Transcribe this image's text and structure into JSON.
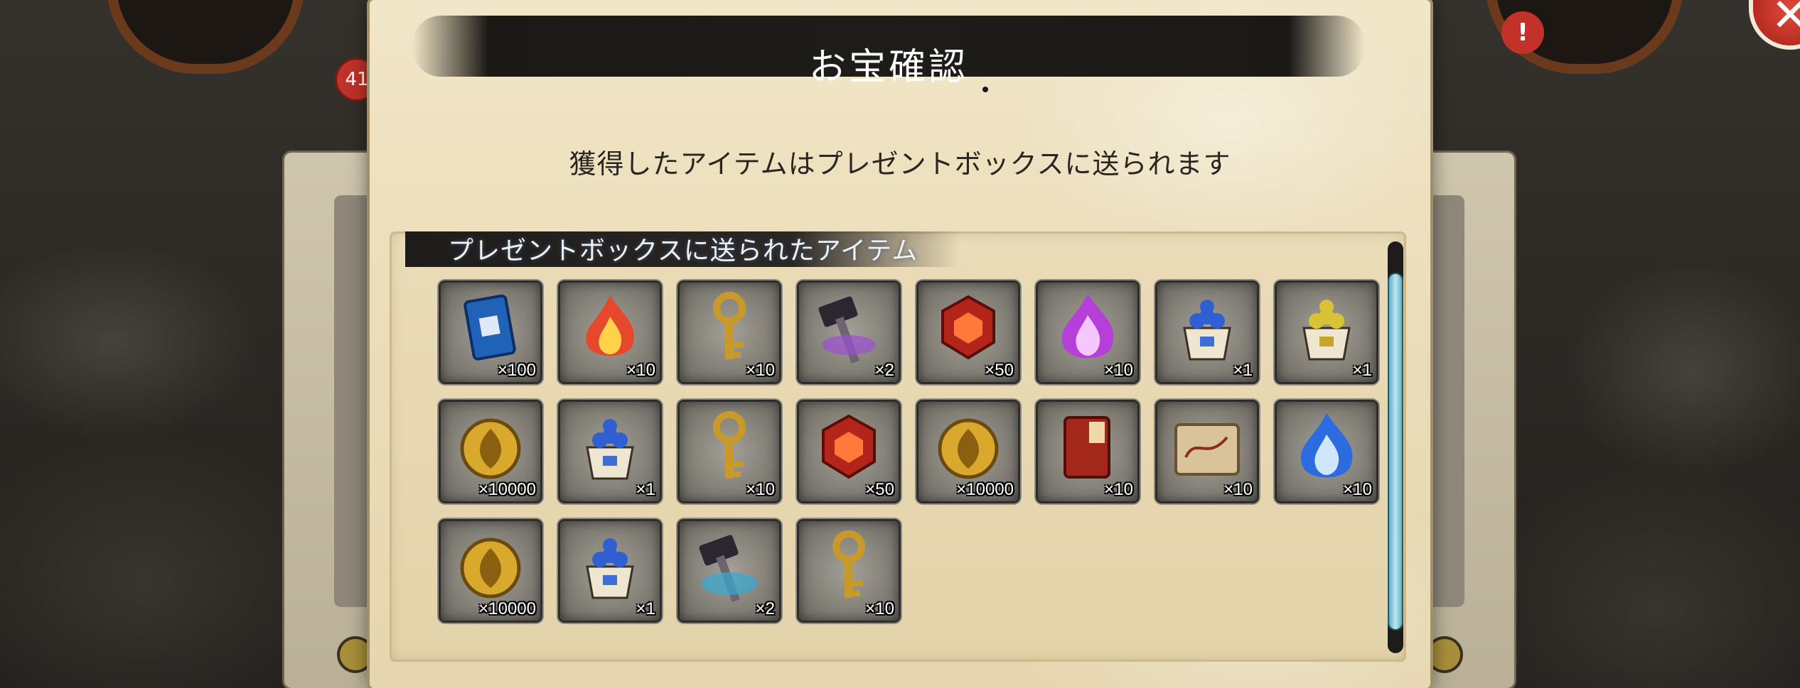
{
  "background": {
    "badge_count": "41",
    "alert_mark": "!"
  },
  "dialog": {
    "title": "お宝確認",
    "close_label": "✕",
    "subtitle": "獲得したアイテムはプレゼントボックスに送られます",
    "section_title": "プレゼントボックスに送られたアイテム",
    "items": [
      {
        "icon": "blue-book-icon",
        "quantity": "×100"
      },
      {
        "icon": "red-flame-icon",
        "quantity": "×10"
      },
      {
        "icon": "gold-key-icon",
        "quantity": "×10"
      },
      {
        "icon": "purple-hammer-icon",
        "quantity": "×2"
      },
      {
        "icon": "red-gem-icon",
        "quantity": "×50"
      },
      {
        "icon": "purple-flame-icon",
        "quantity": "×10"
      },
      {
        "icon": "blue-dango-cup-icon",
        "quantity": "×1"
      },
      {
        "icon": "yellow-dango-cup-icon",
        "quantity": "×1"
      },
      {
        "icon": "gold-coin-icon",
        "quantity": "×10000"
      },
      {
        "icon": "blue-dango-cup-icon",
        "quantity": "×1"
      },
      {
        "icon": "gold-key-icon",
        "quantity": "×10"
      },
      {
        "icon": "red-gem-icon",
        "quantity": "×50"
      },
      {
        "icon": "gold-coin-icon",
        "quantity": "×10000"
      },
      {
        "icon": "red-book-icon",
        "quantity": "×10"
      },
      {
        "icon": "scroll-map-icon",
        "quantity": "×10"
      },
      {
        "icon": "blue-flame-icon",
        "quantity": "×10"
      },
      {
        "icon": "gold-coin-icon",
        "quantity": "×10000"
      },
      {
        "icon": "blue-dango-cup-icon",
        "quantity": "×1"
      },
      {
        "icon": "blue-hammer-icon",
        "quantity": "×2"
      },
      {
        "icon": "gold-key-icon",
        "quantity": "×10"
      }
    ]
  },
  "colors": {
    "dialog_paper": "#ebdebb",
    "title_band": "#1e1c19",
    "close_button": "#c4302a",
    "scroll_thumb": "#7cc7da"
  }
}
